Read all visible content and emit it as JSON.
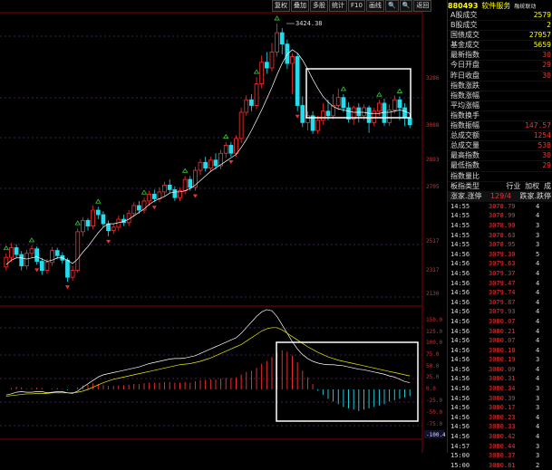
{
  "toolbar": {
    "buttons": [
      "复权",
      "叠加",
      "多股",
      "统计",
      "F10",
      "画线",
      "🔍",
      "🔍",
      "返回"
    ]
  },
  "header": {
    "code": "880493",
    "name": "软件服务",
    "tag": "融统联动"
  },
  "info": [
    {
      "label": "A股成交",
      "value": "2579"
    },
    {
      "label": "B股成交",
      "value": "2"
    },
    {
      "label": "国债成交",
      "value": "27957"
    },
    {
      "label": "基金成交",
      "value": "5659"
    },
    {
      "label": "最新指数",
      "value": "30"
    },
    {
      "label": "今日开盘",
      "value": "29"
    },
    {
      "label": "昨日收盘",
      "value": "30"
    },
    {
      "label": "指数涨跌",
      "value": ""
    },
    {
      "label": "指数涨幅",
      "value": ""
    },
    {
      "label": "平均涨幅",
      "value": ""
    },
    {
      "label": "指数换手",
      "value": ""
    },
    {
      "label": "指数振幅",
      "value": "147.57"
    },
    {
      "label": "总成交额",
      "value": "1254"
    },
    {
      "label": "总成交量",
      "value": "538"
    },
    {
      "label": "最高指数",
      "value": "30"
    },
    {
      "label": "最低指数",
      "value": "29"
    },
    {
      "label": "指数量比",
      "value": ""
    },
    {
      "label": "板指类型",
      "value": "行业 加权 成"
    }
  ],
  "stats_header": {
    "left": "涨家.涨停",
    "mid": "129/4",
    "right": "跌家.跌停"
  },
  "ticks": [
    {
      "time": "14:55",
      "price": "3078.79",
      "vol": "4"
    },
    {
      "time": "14:55",
      "price": "3078.99",
      "vol": "4"
    },
    {
      "time": "14:55",
      "price": "3078.90",
      "vol": "3"
    },
    {
      "time": "14:55",
      "price": "3078.63",
      "vol": "3"
    },
    {
      "time": "14:55",
      "price": "3078.95",
      "vol": "3"
    },
    {
      "time": "14:56",
      "price": "3079.30",
      "vol": "5"
    },
    {
      "time": "14:56",
      "price": "3079.63",
      "vol": "4"
    },
    {
      "time": "14:56",
      "price": "3079.37",
      "vol": "4"
    },
    {
      "time": "14:56",
      "price": "3079.47",
      "vol": "4"
    },
    {
      "time": "14:56",
      "price": "3079.74",
      "vol": "4"
    },
    {
      "time": "14:56",
      "price": "3079.87",
      "vol": "4"
    },
    {
      "time": "14:56",
      "price": "3079.93",
      "vol": "4"
    },
    {
      "time": "14:56",
      "price": "3080.07",
      "vol": "4"
    },
    {
      "time": "14:56",
      "price": "3080.21",
      "vol": "4"
    },
    {
      "time": "14:56",
      "price": "3080.07",
      "vol": "4"
    },
    {
      "time": "14:56",
      "price": "3080.18",
      "vol": "4"
    },
    {
      "time": "14:56",
      "price": "3080.19",
      "vol": "3"
    },
    {
      "time": "14:56",
      "price": "3080.09",
      "vol": "4"
    },
    {
      "time": "14:56",
      "price": "3080.31",
      "vol": "4"
    },
    {
      "time": "14:56",
      "price": "3080.34",
      "vol": "3"
    },
    {
      "time": "14:56",
      "price": "3080.39",
      "vol": "3"
    },
    {
      "time": "14:56",
      "price": "3080.17",
      "vol": "3"
    },
    {
      "time": "14:56",
      "price": "3080.23",
      "vol": "4"
    },
    {
      "time": "14:56",
      "price": "3080.33",
      "vol": "4"
    },
    {
      "time": "14:56",
      "price": "3080.42",
      "vol": "4"
    },
    {
      "time": "14:57",
      "price": "3080.44",
      "vol": "3"
    },
    {
      "time": "15:00",
      "price": "3080.37",
      "vol": "3"
    },
    {
      "time": "15:00",
      "price": "3080.81",
      "vol": "2"
    }
  ],
  "kline": {
    "peak_label": "3424.38",
    "y_labels_main": [
      "3286",
      "3088",
      "2893",
      "2705",
      "2517",
      "2317",
      "2130"
    ],
    "y_labels_macd": [
      "150.0",
      "125.0",
      "100.0",
      "75.0",
      "50.0",
      "25.0",
      "0.0",
      "-25.0",
      "-50.0",
      "-75.0",
      "-100.4"
    ],
    "candles": [
      [
        2996,
        3013,
        2990,
        3020
      ],
      [
        3013,
        3030,
        3005,
        3038
      ],
      [
        3030,
        3018,
        3012,
        3036
      ],
      [
        3018,
        2998,
        2990,
        3024
      ],
      [
        2998,
        3020,
        2992,
        3026
      ],
      [
        3020,
        3028,
        3012,
        3034
      ],
      [
        3028,
        3006,
        3000,
        3032
      ],
      [
        3006,
        2990,
        2982,
        3012
      ],
      [
        2990,
        3004,
        2984,
        3010
      ],
      [
        3004,
        3025,
        2998,
        3031
      ],
      [
        3025,
        3016,
        3010,
        3030
      ],
      [
        3016,
        3008,
        3002,
        3022
      ],
      [
        3008,
        2978,
        2970,
        3012
      ],
      [
        2978,
        2990,
        2972,
        2998
      ],
      [
        2990,
        3058,
        2986,
        3064
      ],
      [
        3058,
        3078,
        3050,
        3084
      ],
      [
        3078,
        3068,
        3060,
        3082
      ],
      [
        3068,
        3096,
        3062,
        3104
      ],
      [
        3096,
        3088,
        3080,
        3102
      ],
      [
        3088,
        3072,
        3066,
        3094
      ],
      [
        3072,
        3060,
        3050,
        3078
      ],
      [
        3060,
        3066,
        3054,
        3072
      ],
      [
        3066,
        3080,
        3060,
        3086
      ],
      [
        3080,
        3074,
        3068,
        3088
      ],
      [
        3074,
        3090,
        3068,
        3096
      ],
      [
        3090,
        3104,
        3084,
        3110
      ],
      [
        3104,
        3096,
        3090,
        3112
      ],
      [
        3096,
        3112,
        3090,
        3118
      ],
      [
        3112,
        3124,
        3104,
        3130
      ],
      [
        3124,
        3116,
        3110,
        3132
      ],
      [
        3116,
        3128,
        3110,
        3136
      ],
      [
        3128,
        3140,
        3120,
        3146
      ],
      [
        3140,
        3132,
        3126,
        3150
      ],
      [
        3132,
        3118,
        3112,
        3138
      ],
      [
        3118,
        3130,
        3112,
        3136
      ],
      [
        3130,
        3150,
        3124,
        3156
      ],
      [
        3150,
        3136,
        3130,
        3156
      ],
      [
        3136,
        3166,
        3130,
        3172
      ],
      [
        3166,
        3180,
        3158,
        3186
      ],
      [
        3180,
        3170,
        3164,
        3190
      ],
      [
        3170,
        3184,
        3164,
        3190
      ],
      [
        3184,
        3174,
        3168,
        3196
      ],
      [
        3174,
        3196,
        3168,
        3202
      ],
      [
        3196,
        3210,
        3188,
        3216
      ],
      [
        3210,
        3196,
        3190,
        3216
      ],
      [
        3196,
        3222,
        3190,
        3228
      ],
      [
        3222,
        3268,
        3214,
        3276
      ],
      [
        3268,
        3290,
        3262,
        3298
      ],
      [
        3290,
        3280,
        3270,
        3300
      ],
      [
        3280,
        3318,
        3274,
        3330
      ],
      [
        3318,
        3356,
        3310,
        3368
      ],
      [
        3356,
        3346,
        3336,
        3374
      ],
      [
        3346,
        3374,
        3340,
        3390
      ],
      [
        3374,
        3408,
        3366,
        3424
      ],
      [
        3408,
        3388,
        3370,
        3416
      ],
      [
        3388,
        3354,
        3344,
        3396
      ],
      [
        3354,
        3366,
        3300,
        3372
      ],
      [
        3366,
        3280,
        3270,
        3372
      ],
      [
        3280,
        3250,
        3242,
        3296
      ],
      [
        3250,
        3262,
        3236,
        3270
      ],
      [
        3262,
        3236,
        3230,
        3270
      ],
      [
        3236,
        3254,
        3230,
        3262
      ],
      [
        3254,
        3270,
        3246,
        3284
      ],
      [
        3270,
        3262,
        3254,
        3290
      ],
      [
        3262,
        3280,
        3256,
        3300
      ],
      [
        3280,
        3294,
        3272,
        3310
      ],
      [
        3294,
        3276,
        3268,
        3300
      ],
      [
        3276,
        3256,
        3250,
        3286
      ],
      [
        3256,
        3276,
        3246,
        3280
      ],
      [
        3276,
        3262,
        3250,
        3284
      ],
      [
        3262,
        3276,
        3254,
        3282
      ],
      [
        3276,
        3250,
        3232,
        3280
      ],
      [
        3250,
        3270,
        3244,
        3276
      ],
      [
        3270,
        3284,
        3262,
        3290
      ],
      [
        3284,
        3250,
        3244,
        3292
      ],
      [
        3250,
        3272,
        3244,
        3282
      ],
      [
        3272,
        3290,
        3266,
        3298
      ],
      [
        3290,
        3276,
        3254,
        3296
      ],
      [
        3276,
        3258,
        3244,
        3284
      ],
      [
        3258,
        3246,
        3240,
        3266
      ]
    ],
    "markers_up": [
      0,
      5,
      14,
      18,
      27,
      35,
      43,
      49,
      53,
      66,
      73,
      77
    ],
    "markers_down": [
      6,
      12,
      20,
      29,
      37,
      44,
      57
    ],
    "ma1": [
      3000,
      3008,
      3012,
      3012,
      3010,
      3012,
      3014,
      3010,
      3006,
      3008,
      3012,
      3012,
      3008,
      3002,
      3010,
      3022,
      3032,
      3044,
      3056,
      3066,
      3072,
      3072,
      3074,
      3076,
      3080,
      3086,
      3092,
      3098,
      3106,
      3112,
      3116,
      3120,
      3126,
      3128,
      3128,
      3130,
      3134,
      3140,
      3148,
      3156,
      3164,
      3170,
      3176,
      3182,
      3188,
      3194,
      3206,
      3220,
      3236,
      3254,
      3272,
      3292,
      3312,
      3334,
      3354,
      3370,
      3378,
      3372,
      3360,
      3344,
      3326,
      3310,
      3296,
      3286,
      3278,
      3274,
      3272,
      3270,
      3268,
      3268,
      3268,
      3266,
      3266,
      3266,
      3268,
      3268,
      3270,
      3272,
      3270,
      3266
    ],
    "macd_hist": [
      0,
      2,
      4,
      3,
      1,
      2,
      3,
      2,
      0,
      1,
      2,
      1,
      -1,
      0,
      3,
      6,
      7,
      9,
      8,
      7,
      5,
      5,
      6,
      6,
      7,
      8,
      8,
      9,
      10,
      10,
      10,
      11,
      11,
      10,
      10,
      11,
      10,
      12,
      14,
      14,
      15,
      15,
      16,
      17,
      17,
      18,
      22,
      26,
      28,
      32,
      38,
      42,
      48,
      55,
      58,
      56,
      50,
      40,
      28,
      18,
      8,
      -2,
      -8,
      -14,
      -18,
      -22,
      -26,
      -28,
      -30,
      -32,
      -30,
      -28,
      -26,
      -24,
      -22,
      -18,
      -16,
      -14,
      -12,
      -10
    ],
    "dif": [
      -10,
      -8,
      -5,
      -4,
      -5,
      -5,
      -4,
      -4,
      -6,
      -5,
      -4,
      -4,
      -6,
      -7,
      -3,
      4,
      10,
      16,
      22,
      26,
      28,
      30,
      32,
      34,
      36,
      38,
      40,
      43,
      46,
      48,
      50,
      52,
      54,
      55,
      55,
      56,
      58,
      60,
      64,
      68,
      72,
      76,
      80,
      84,
      88,
      92,
      100,
      110,
      120,
      130,
      138,
      142,
      140,
      130,
      115,
      100,
      85,
      72,
      62,
      55,
      50,
      47,
      45,
      44,
      44,
      43,
      42,
      40,
      38,
      36,
      35,
      33,
      31,
      29,
      27,
      24,
      22,
      18,
      14,
      12
    ],
    "dea": [
      -12,
      -11,
      -10,
      -9,
      -8,
      -8,
      -7,
      -7,
      -7,
      -6,
      -6,
      -6,
      -6,
      -6,
      -5,
      -3,
      0,
      4,
      8,
      12,
      15,
      18,
      20,
      22,
      24,
      26,
      28,
      30,
      32,
      34,
      36,
      38,
      40,
      42,
      44,
      45,
      46,
      48,
      50,
      53,
      56,
      60,
      64,
      68,
      72,
      76,
      80,
      86,
      92,
      98,
      104,
      108,
      110,
      110,
      106,
      100,
      94,
      88,
      82,
      76,
      71,
      66,
      62,
      58,
      55,
      52,
      50,
      48,
      46,
      44,
      42,
      40,
      38,
      36,
      34,
      32,
      30,
      28,
      26,
      24
    ]
  }
}
